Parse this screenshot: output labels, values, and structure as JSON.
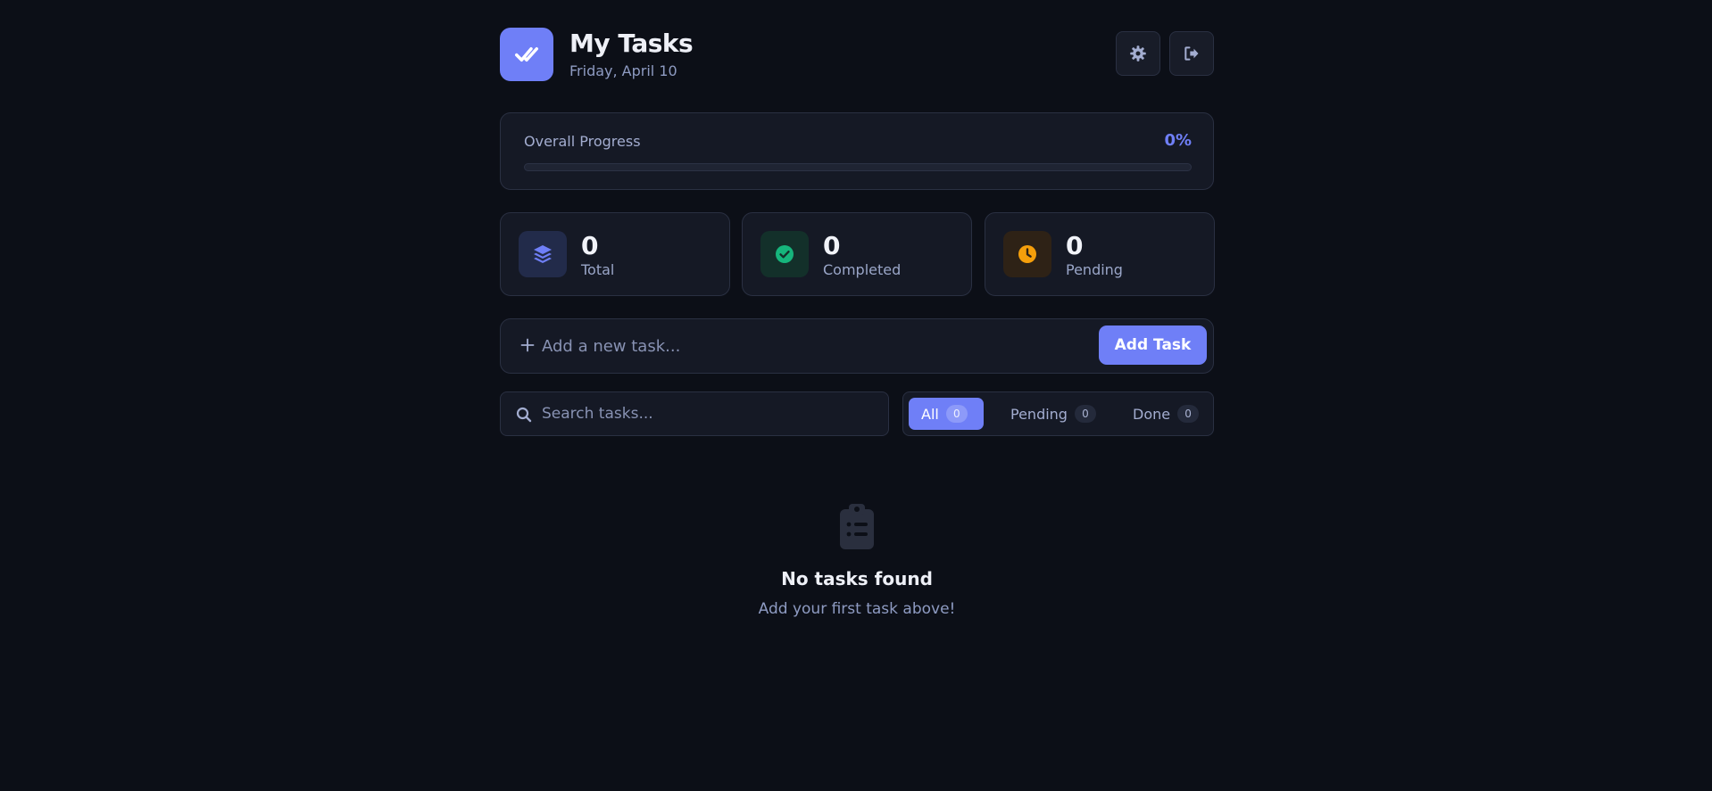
{
  "header": {
    "title": "My Tasks",
    "date": "Friday, April 10",
    "logo_icon": "double-check-icon",
    "settings_icon": "gear-icon",
    "logout_icon": "logout-icon"
  },
  "progress": {
    "label": "Overall Progress",
    "value_text": "0%",
    "percent": 0
  },
  "stats": [
    {
      "value": "0",
      "label": "Total",
      "icon": "layers-icon",
      "color": "#6f7ff7"
    },
    {
      "value": "0",
      "label": "Completed",
      "icon": "check-circle-icon",
      "color": "#16b57c"
    },
    {
      "value": "0",
      "label": "Pending",
      "icon": "clock-icon",
      "color": "#f59f0b"
    }
  ],
  "add_task": {
    "placeholder": "Add a new task...",
    "button_label": "Add Task"
  },
  "search": {
    "placeholder": "Search tasks..."
  },
  "filters": [
    {
      "label": "All",
      "count": "0",
      "active": true
    },
    {
      "label": "Pending",
      "count": "0",
      "active": false
    },
    {
      "label": "Done",
      "count": "0",
      "active": false
    }
  ],
  "empty_state": {
    "icon": "clipboard-list-icon",
    "title": "No tasks found",
    "subtitle": "Add your first task above!"
  },
  "colors": {
    "accent": "#6f7ff7",
    "background": "#0c0f17",
    "card": "#151925"
  }
}
